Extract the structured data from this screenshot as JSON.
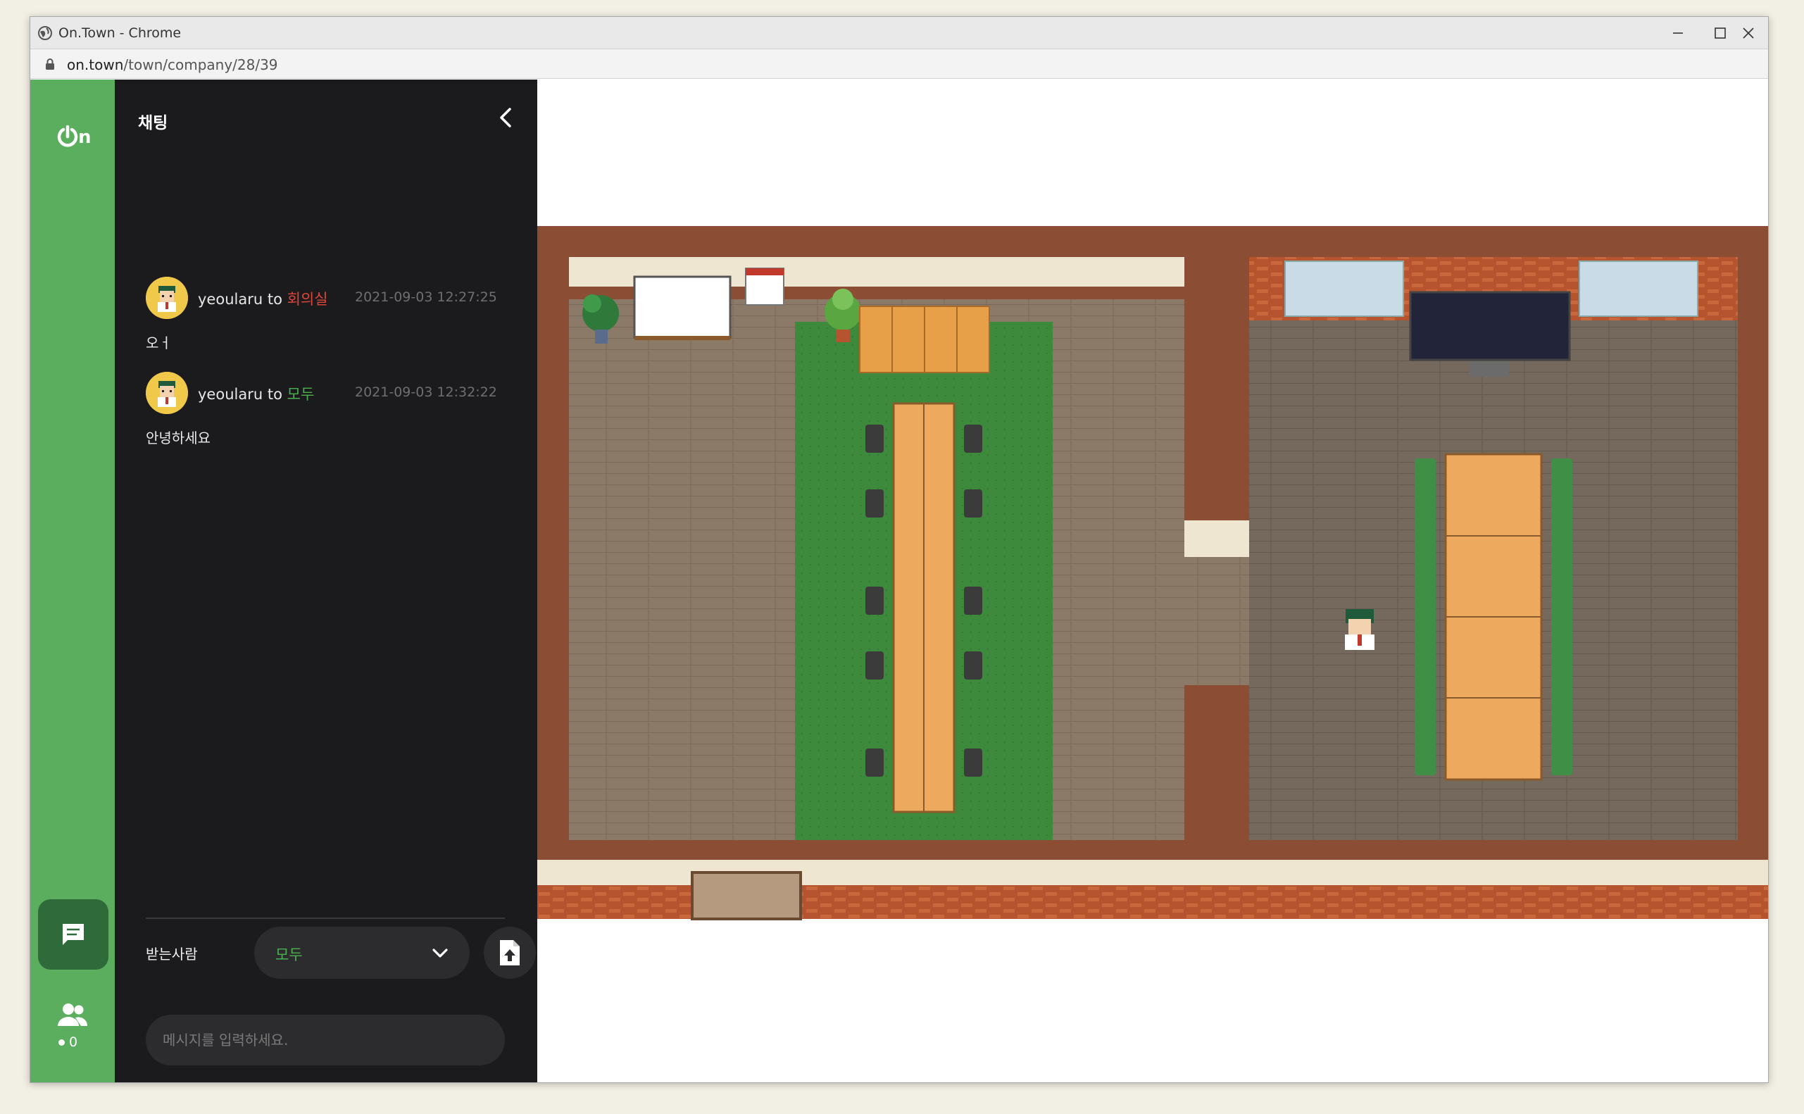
{
  "browser": {
    "title": "On.Town - Chrome",
    "url_host": "on.town",
    "url_path": "/town/company/28/39"
  },
  "rail": {
    "logo_text": "On",
    "online_count": "0"
  },
  "chat": {
    "title": "채팅",
    "messages": [
      {
        "sender": "yeoularu",
        "to_word": "to",
        "recipient": "회의실",
        "time": "2021-09-03 12:27:25",
        "text": "오ㅓ"
      },
      {
        "sender": "yeoularu",
        "to_word": "to",
        "recipient": "모두",
        "time": "2021-09-03 12:32:22",
        "text": "안녕하세요"
      }
    ],
    "recipient_label": "받는사람",
    "recipient_value": "모두",
    "input_placeholder": "메시지를 입력하세요."
  },
  "colors": {
    "rail_green": "#5aae5e",
    "panel_dark": "#1b1b1d",
    "room_recipient": "#e0453a",
    "all_recipient": "#4caf50"
  },
  "icons": [
    "globe-icon",
    "minimize-icon",
    "maximize-icon",
    "close-icon",
    "lock-icon",
    "chevron-left-icon",
    "chat-bubble-icon",
    "users-icon",
    "chevron-down-icon",
    "file-upload-icon"
  ]
}
